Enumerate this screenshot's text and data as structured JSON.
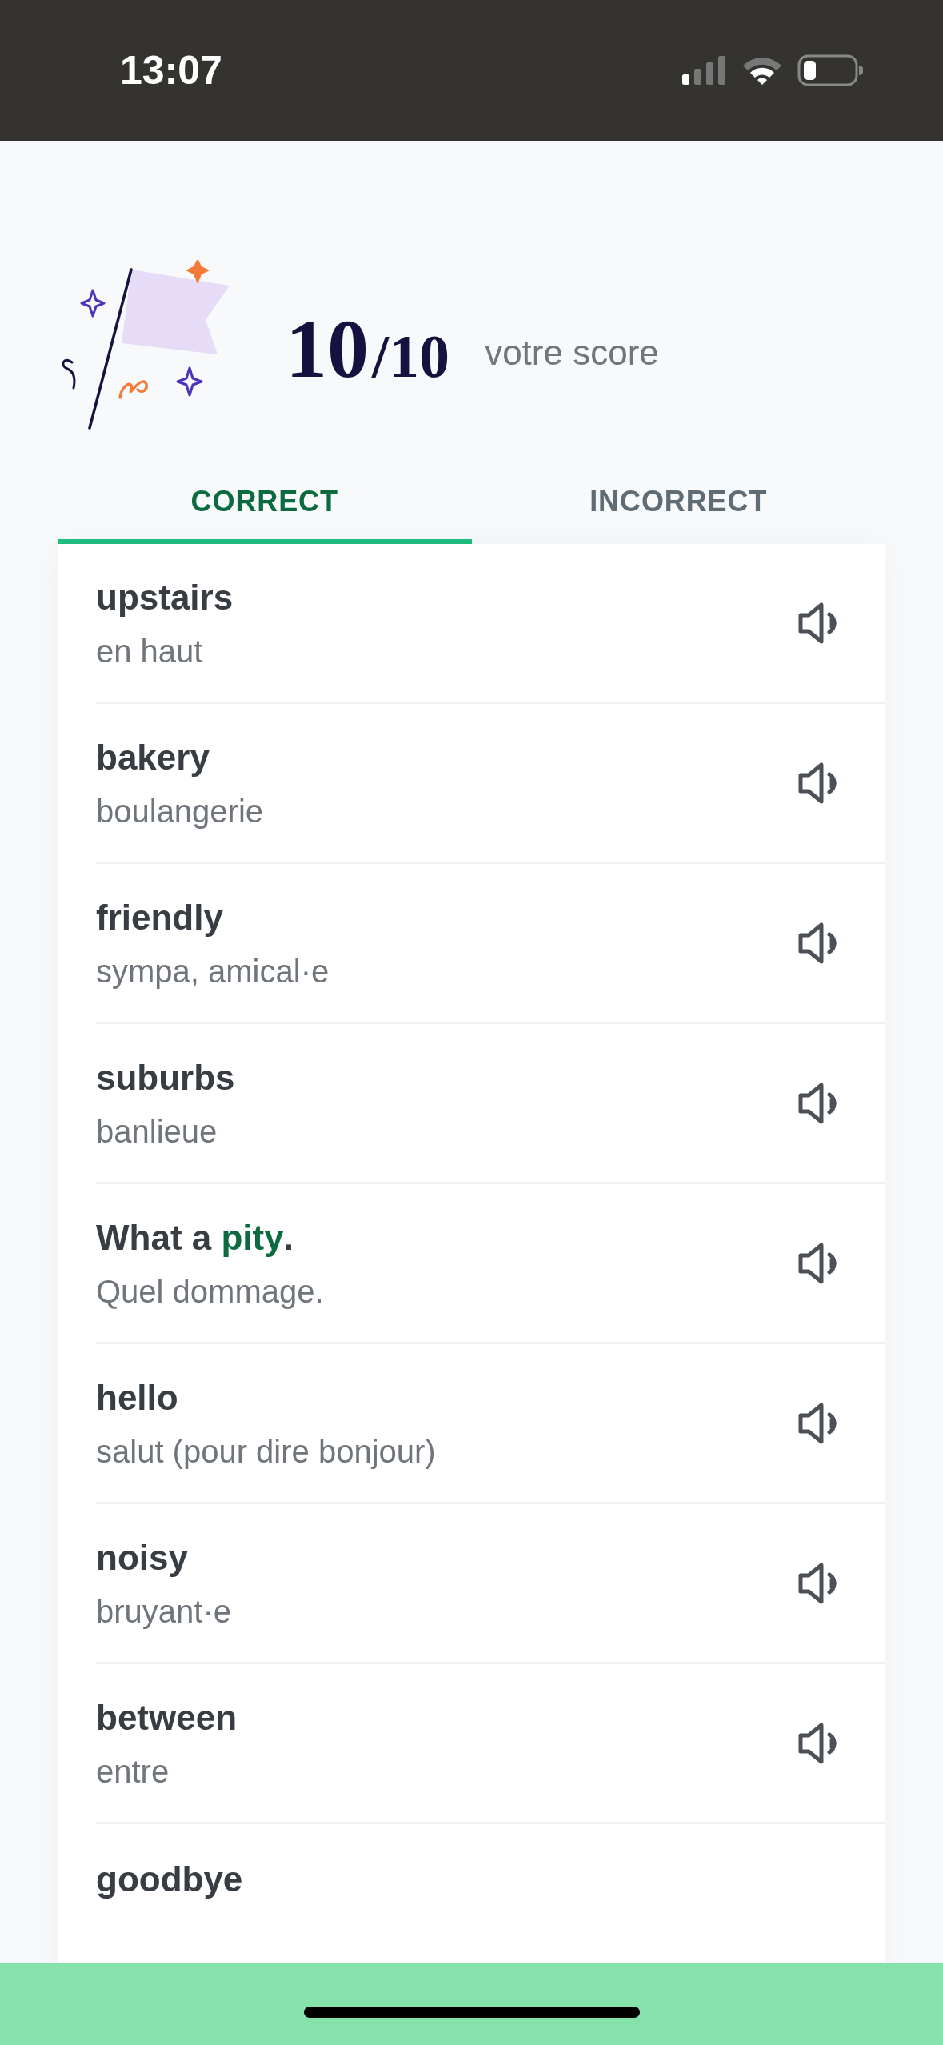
{
  "status_bar": {
    "time": "13:07"
  },
  "score": {
    "value": "10",
    "total": "/10",
    "label": "votre score"
  },
  "tabs": [
    {
      "label": "CORRECT",
      "selected": true
    },
    {
      "label": "INCORRECT",
      "selected": false
    }
  ],
  "words": [
    {
      "word": "upstairs",
      "translation": "en haut"
    },
    {
      "word": "bakery",
      "translation": "boulangerie"
    },
    {
      "word": "friendly",
      "translation": "sympa, amical·e"
    },
    {
      "word": "suburbs",
      "translation": "banlieue"
    },
    {
      "word": "What a **pity**.",
      "translation": "Quel dommage."
    },
    {
      "word": "hello",
      "translation": "salut (pour dire bonjour)"
    },
    {
      "word": "noisy",
      "translation": "bruyant·e"
    },
    {
      "word": "between",
      "translation": "entre"
    },
    {
      "word": "goodbye"
    }
  ]
}
